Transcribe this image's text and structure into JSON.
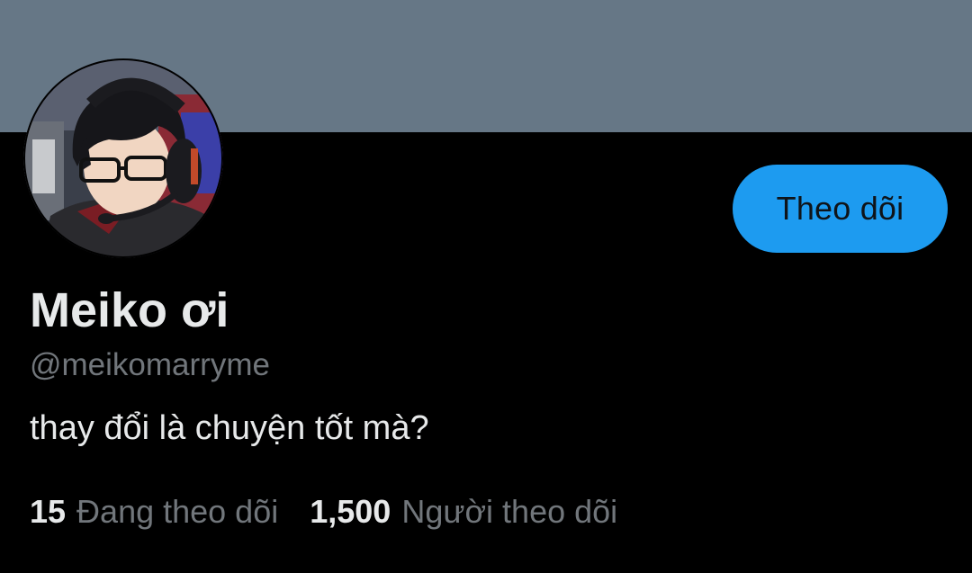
{
  "profile": {
    "display_name": "Meiko ơi",
    "handle": "@meikomarryme",
    "bio": "thay đổi là chuyện tốt mà?",
    "follow_button_label": "Theo dõi"
  },
  "stats": {
    "following_count": "15",
    "following_label": "Đang theo dõi",
    "followers_count": "1,500",
    "followers_label": "Người theo dõi"
  },
  "colors": {
    "banner": "#667786",
    "background": "#000000",
    "accent": "#1d9bf0",
    "primary_text": "#e7e9ea",
    "secondary_text": "#71767b"
  }
}
